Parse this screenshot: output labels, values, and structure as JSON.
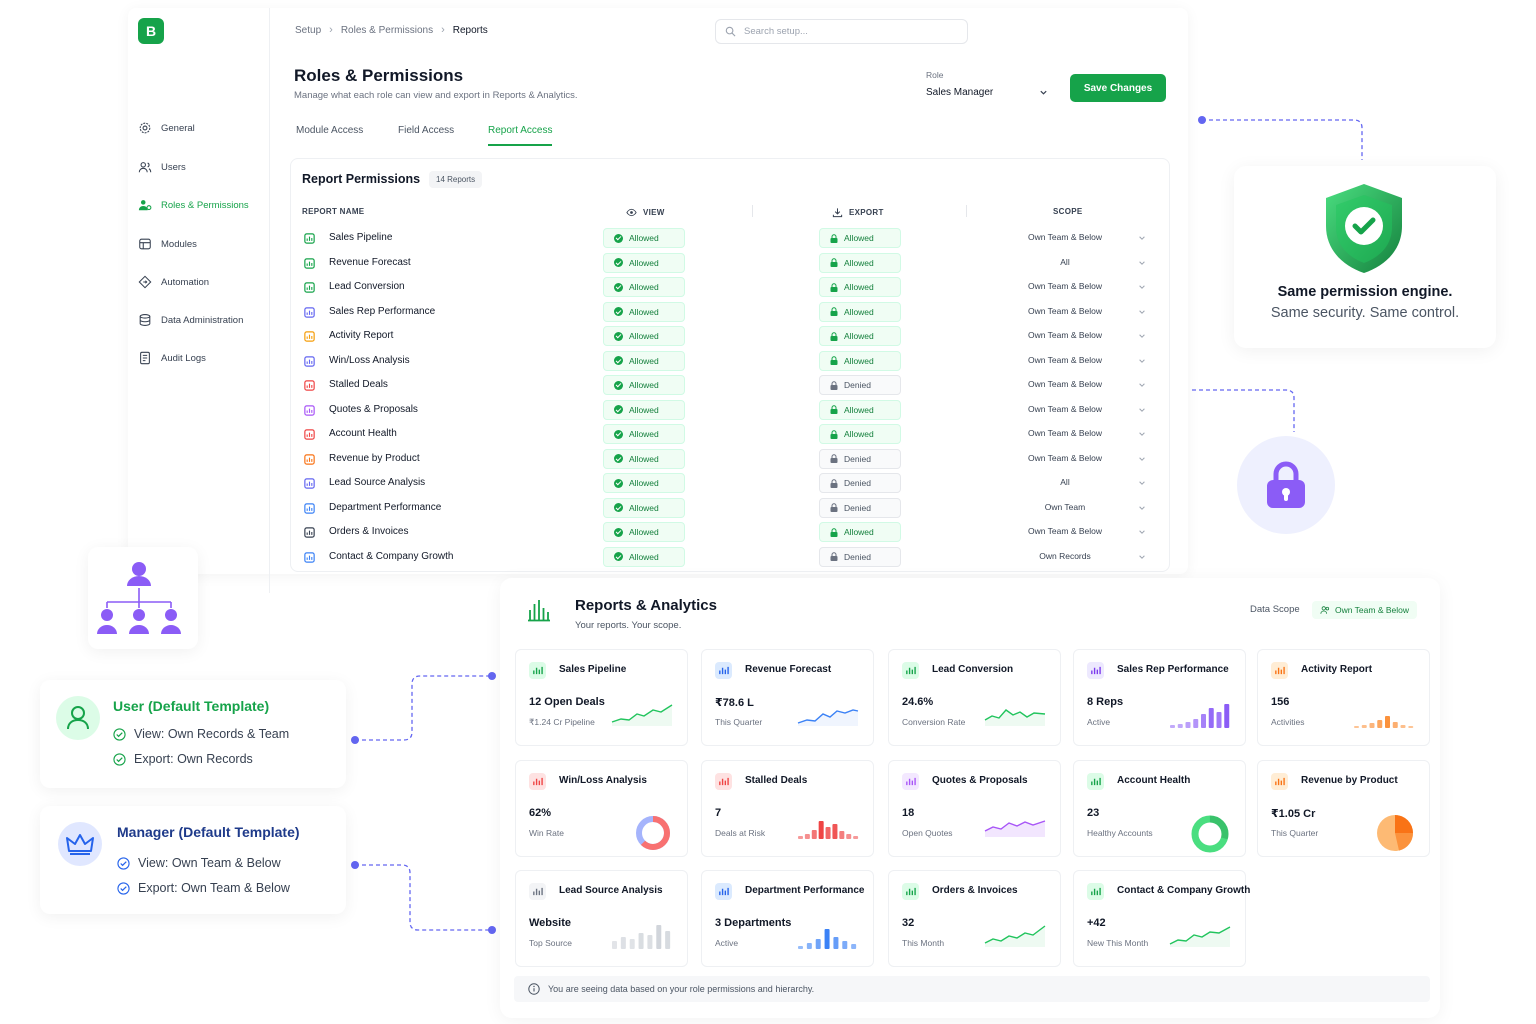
{
  "app": {
    "logo_letter": "B"
  },
  "sidebar": {
    "items": [
      {
        "label": "General",
        "icon": "gear-icon"
      },
      {
        "label": "Users",
        "icon": "users-icon"
      },
      {
        "label": "Roles & Permissions",
        "icon": "roles-icon",
        "active": true
      },
      {
        "label": "Modules",
        "icon": "modules-icon"
      },
      {
        "label": "Automation",
        "icon": "automation-icon"
      },
      {
        "label": "Data Administration",
        "icon": "database-icon"
      },
      {
        "label": "Audit Logs",
        "icon": "audit-icon"
      }
    ]
  },
  "breadcrumb": [
    "Setup",
    "Roles & Permissions",
    "Reports"
  ],
  "search": {
    "placeholder": "Search setup..."
  },
  "header": {
    "title": "Roles & Permissions",
    "subtitle": "Manage what each role can view and export in Reports & Analytics.",
    "role_label": "Role",
    "role_value": "Sales Manager",
    "save_label": "Save Changes"
  },
  "tabs": [
    {
      "label": "Module Access"
    },
    {
      "label": "Field Access"
    },
    {
      "label": "Report Access",
      "active": true
    }
  ],
  "permissions": {
    "title": "Report Permissions",
    "count": "14 Reports",
    "columns": {
      "name": "REPORT NAME",
      "view": "VIEW",
      "export": "EXPORT",
      "scope": "SCOPE"
    },
    "rows": [
      {
        "name": "Sales Pipeline",
        "view": "Allowed",
        "export": "Allowed",
        "scope": "Own Team & Below",
        "icon_color": "#16a34a"
      },
      {
        "name": "Revenue Forecast",
        "view": "Allowed",
        "export": "Allowed",
        "scope": "All",
        "icon_color": "#16a34a"
      },
      {
        "name": "Lead Conversion",
        "view": "Allowed",
        "export": "Allowed",
        "scope": "Own Team & Below",
        "icon_color": "#16a34a"
      },
      {
        "name": "Sales Rep Performance",
        "view": "Allowed",
        "export": "Allowed",
        "scope": "Own Team & Below",
        "icon_color": "#6366f1"
      },
      {
        "name": "Activity Report",
        "view": "Allowed",
        "export": "Allowed",
        "scope": "Own Team & Below",
        "icon_color": "#f59e0b"
      },
      {
        "name": "Win/Loss Analysis",
        "view": "Allowed",
        "export": "Allowed",
        "scope": "Own Team & Below",
        "icon_color": "#6366f1"
      },
      {
        "name": "Stalled Deals",
        "view": "Allowed",
        "export": "Denied",
        "scope": "Own Team & Below",
        "icon_color": "#ef4444"
      },
      {
        "name": "Quotes & Proposals",
        "view": "Allowed",
        "export": "Allowed",
        "scope": "Own Team & Below",
        "icon_color": "#a855f7"
      },
      {
        "name": "Account Health",
        "view": "Allowed",
        "export": "Allowed",
        "scope": "Own Team & Below",
        "icon_color": "#ef4444"
      },
      {
        "name": "Revenue by Product",
        "view": "Allowed",
        "export": "Denied",
        "scope": "Own Team & Below",
        "icon_color": "#f97316"
      },
      {
        "name": "Lead Source Analysis",
        "view": "Allowed",
        "export": "Denied",
        "scope": "All",
        "icon_color": "#6366f1"
      },
      {
        "name": "Department Performance",
        "view": "Allowed",
        "export": "Denied",
        "scope": "Own Team",
        "icon_color": "#3b82f6"
      },
      {
        "name": "Orders & Invoices",
        "view": "Allowed",
        "export": "Allowed",
        "scope": "Own Team & Below",
        "icon_color": "#374151"
      },
      {
        "name": "Contact & Company Growth",
        "view": "Allowed",
        "export": "Denied",
        "scope": "Own Records",
        "icon_color": "#3b82f6"
      }
    ]
  },
  "promo": {
    "title": "Same permission engine.",
    "subtitle": "Same security. Same control."
  },
  "templates": [
    {
      "title": "User (Default Template)",
      "color": "#16a34a",
      "lines": [
        "View: Own Records & Team",
        "Export: Own Records"
      ]
    },
    {
      "title": "Manager (Default Template)",
      "color": "#1e3a8a",
      "lines": [
        "View: Own Team & Below",
        "Export: Own Team & Below"
      ]
    }
  ],
  "analytics": {
    "title": "Reports & Analytics",
    "subtitle": "Your reports. Your scope.",
    "scope_label": "Data Scope",
    "scope_value": "Own Team & Below",
    "note": "You are seeing data based on your role permissions and hierarchy.",
    "tiles": [
      {
        "name": "Sales Pipeline",
        "value": "12 Open Deals",
        "label": "₹1.24 Cr Pipeline",
        "icon_bg": "#dcfce7",
        "icon_color": "#16a34a",
        "chart": "line-green"
      },
      {
        "name": "Revenue Forecast",
        "value": "₹78.6 L",
        "label": "This Quarter",
        "icon_bg": "#dbeafe",
        "icon_color": "#2563eb",
        "chart": "line-blue"
      },
      {
        "name": "Lead Conversion",
        "value": "24.6%",
        "label": "Conversion Rate",
        "icon_bg": "#dcfce7",
        "icon_color": "#16a34a",
        "chart": "line-green2"
      },
      {
        "name": "Sales Rep Performance",
        "value": "8 Reps",
        "label": "Active",
        "icon_bg": "#ede9fe",
        "icon_color": "#7c3aed",
        "chart": "bars-purple"
      },
      {
        "name": "Activity Report",
        "value": "156",
        "label": "Activities",
        "icon_bg": "#ffedd5",
        "icon_color": "#f97316",
        "chart": "bars-orange"
      },
      {
        "name": "Win/Loss Analysis",
        "value": "62%",
        "label": "Win Rate",
        "icon_bg": "#fee2e2",
        "icon_color": "#ef4444",
        "chart": "donut-winloss"
      },
      {
        "name": "Stalled Deals",
        "value": "7",
        "label": "Deals at Risk",
        "icon_bg": "#fee2e2",
        "icon_color": "#ef4444",
        "chart": "bars-red"
      },
      {
        "name": "Quotes & Proposals",
        "value": "18",
        "label": "Open Quotes",
        "icon_bg": "#f3e8ff",
        "icon_color": "#a855f7",
        "chart": "area-purple"
      },
      {
        "name": "Account Health",
        "value": "23",
        "label": "Healthy Accounts",
        "icon_bg": "#dcfce7",
        "icon_color": "#16a34a",
        "chart": "donut-green"
      },
      {
        "name": "Revenue by Product",
        "value": "₹1.05 Cr",
        "label": "This Quarter",
        "icon_bg": "#ffedd5",
        "icon_color": "#f97316",
        "chart": "pie-orange"
      },
      {
        "name": "Lead Source Analysis",
        "value": "Website",
        "label": "Top Source",
        "icon_bg": "#f3f4f6",
        "icon_color": "#6b7280",
        "chart": "bars-gray"
      },
      {
        "name": "Department Performance",
        "value": "3 Departments",
        "label": "Active",
        "icon_bg": "#dbeafe",
        "icon_color": "#2563eb",
        "chart": "bars-blue"
      },
      {
        "name": "Orders & Invoices",
        "value": "32",
        "label": "This Month",
        "icon_bg": "#dcfce7",
        "icon_color": "#16a34a",
        "chart": "line-green3"
      },
      {
        "name": "Contact & Company Growth",
        "value": "+42",
        "label": "New This Month",
        "icon_bg": "#dcfce7",
        "icon_color": "#16a34a",
        "chart": "line-green4"
      }
    ]
  }
}
